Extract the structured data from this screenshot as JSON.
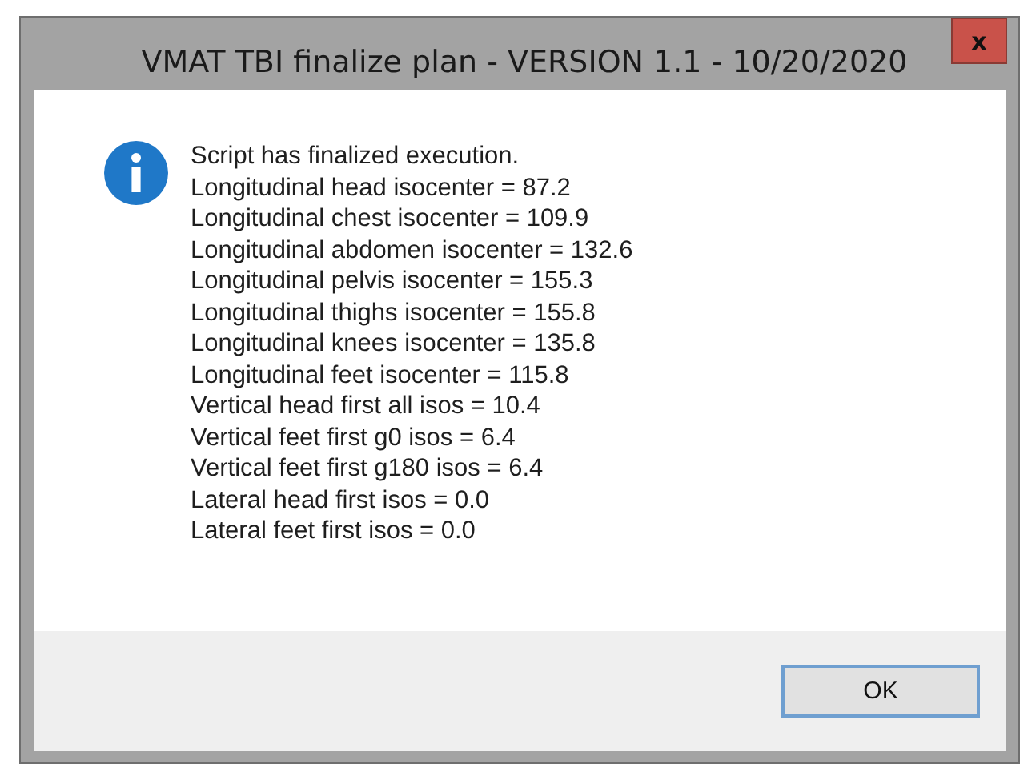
{
  "window": {
    "title": "VMAT TBI finalize plan - VERSION 1.1 - 10/20/2020",
    "close": "x"
  },
  "message": {
    "kind": "info",
    "lines": [
      "Script has finalized execution.",
      "Longitudinal head isocenter = 87.2",
      "Longitudinal chest isocenter = 109.9",
      "Longitudinal abdomen isocenter = 132.6",
      "Longitudinal pelvis isocenter = 155.3",
      "Longitudinal thighs isocenter = 155.8",
      "Longitudinal knees isocenter = 135.8",
      "Longitudinal feet isocenter = 115.8",
      "Vertical head first all isos = 10.4",
      "Vertical feet first g0 isos = 6.4",
      "Vertical feet first g180 isos = 6.4",
      "Lateral head first isos = 0.0",
      "Lateral feet first isos = 0.0"
    ]
  },
  "buttons": [
    "OK"
  ]
}
